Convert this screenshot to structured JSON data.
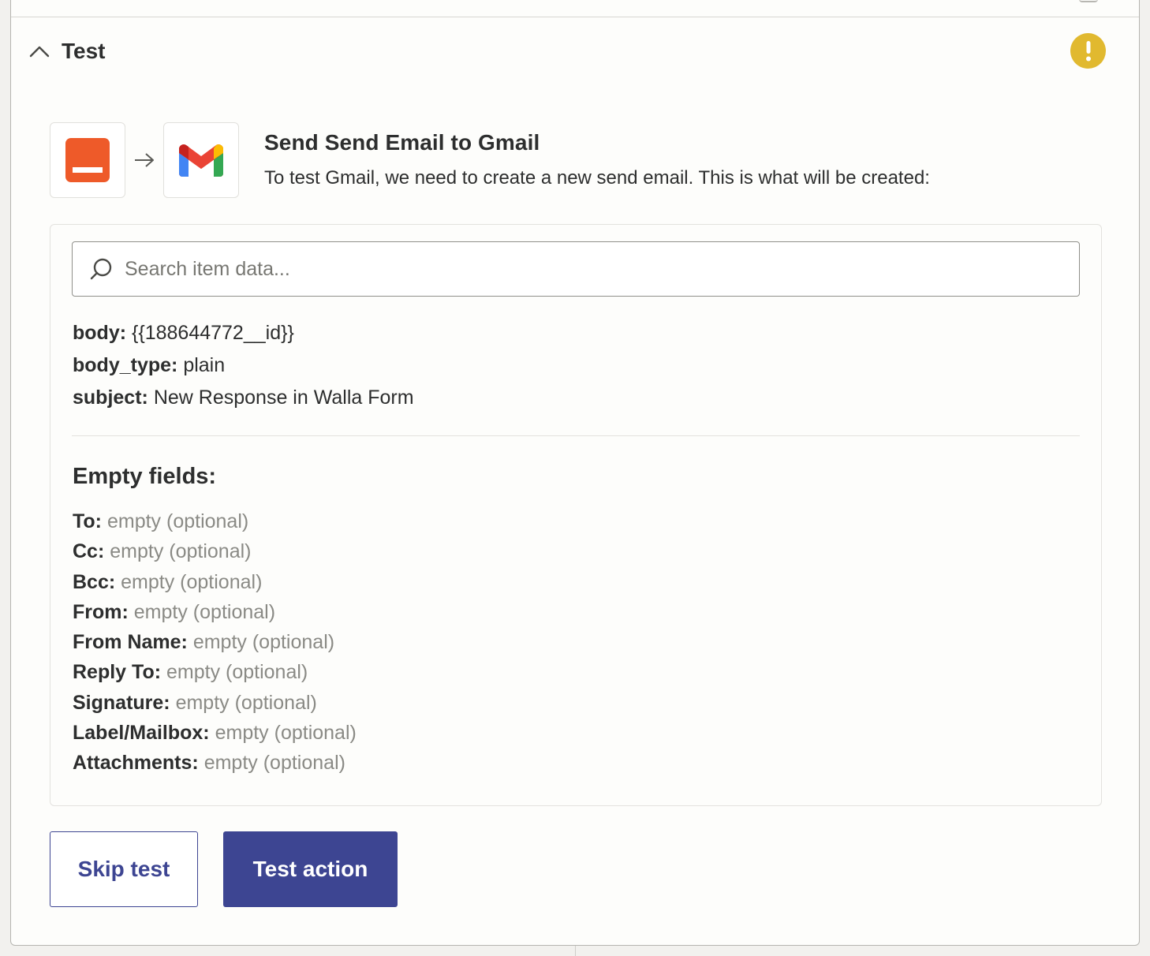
{
  "section": {
    "title": "Test",
    "warning_icon": "alert-exclamation-icon",
    "warning_color": "#e1b92f"
  },
  "step": {
    "source_app_icon": "form-app-icon",
    "source_app_color": "#ee5a29",
    "target_app_icon": "gmail-icon",
    "title": "Send Send Email to Gmail",
    "description": "To test Gmail, we need to create a new send email. This is what will be created:"
  },
  "search": {
    "placeholder": "Search item data..."
  },
  "fields": [
    {
      "key": "body:",
      "value": "{{188644772__id}}"
    },
    {
      "key": "body_type:",
      "value": "plain"
    },
    {
      "key": "subject:",
      "value": "New Response in Walla Form"
    }
  ],
  "empty_fields": {
    "heading": "Empty fields:",
    "items": [
      {
        "key": "To:",
        "value": "empty (optional)"
      },
      {
        "key": "Cc:",
        "value": "empty (optional)"
      },
      {
        "key": "Bcc:",
        "value": "empty (optional)"
      },
      {
        "key": "From:",
        "value": "empty (optional)"
      },
      {
        "key": "From Name:",
        "value": "empty (optional)"
      },
      {
        "key": "Reply To:",
        "value": "empty (optional)"
      },
      {
        "key": "Signature:",
        "value": "empty (optional)"
      },
      {
        "key": "Label/Mailbox:",
        "value": "empty (optional)"
      },
      {
        "key": "Attachments:",
        "value": "empty (optional)"
      }
    ]
  },
  "buttons": {
    "skip_label": "Skip test",
    "test_label": "Test action"
  },
  "colors": {
    "primary": "#3d4592",
    "muted_text": "#8a8a85"
  }
}
